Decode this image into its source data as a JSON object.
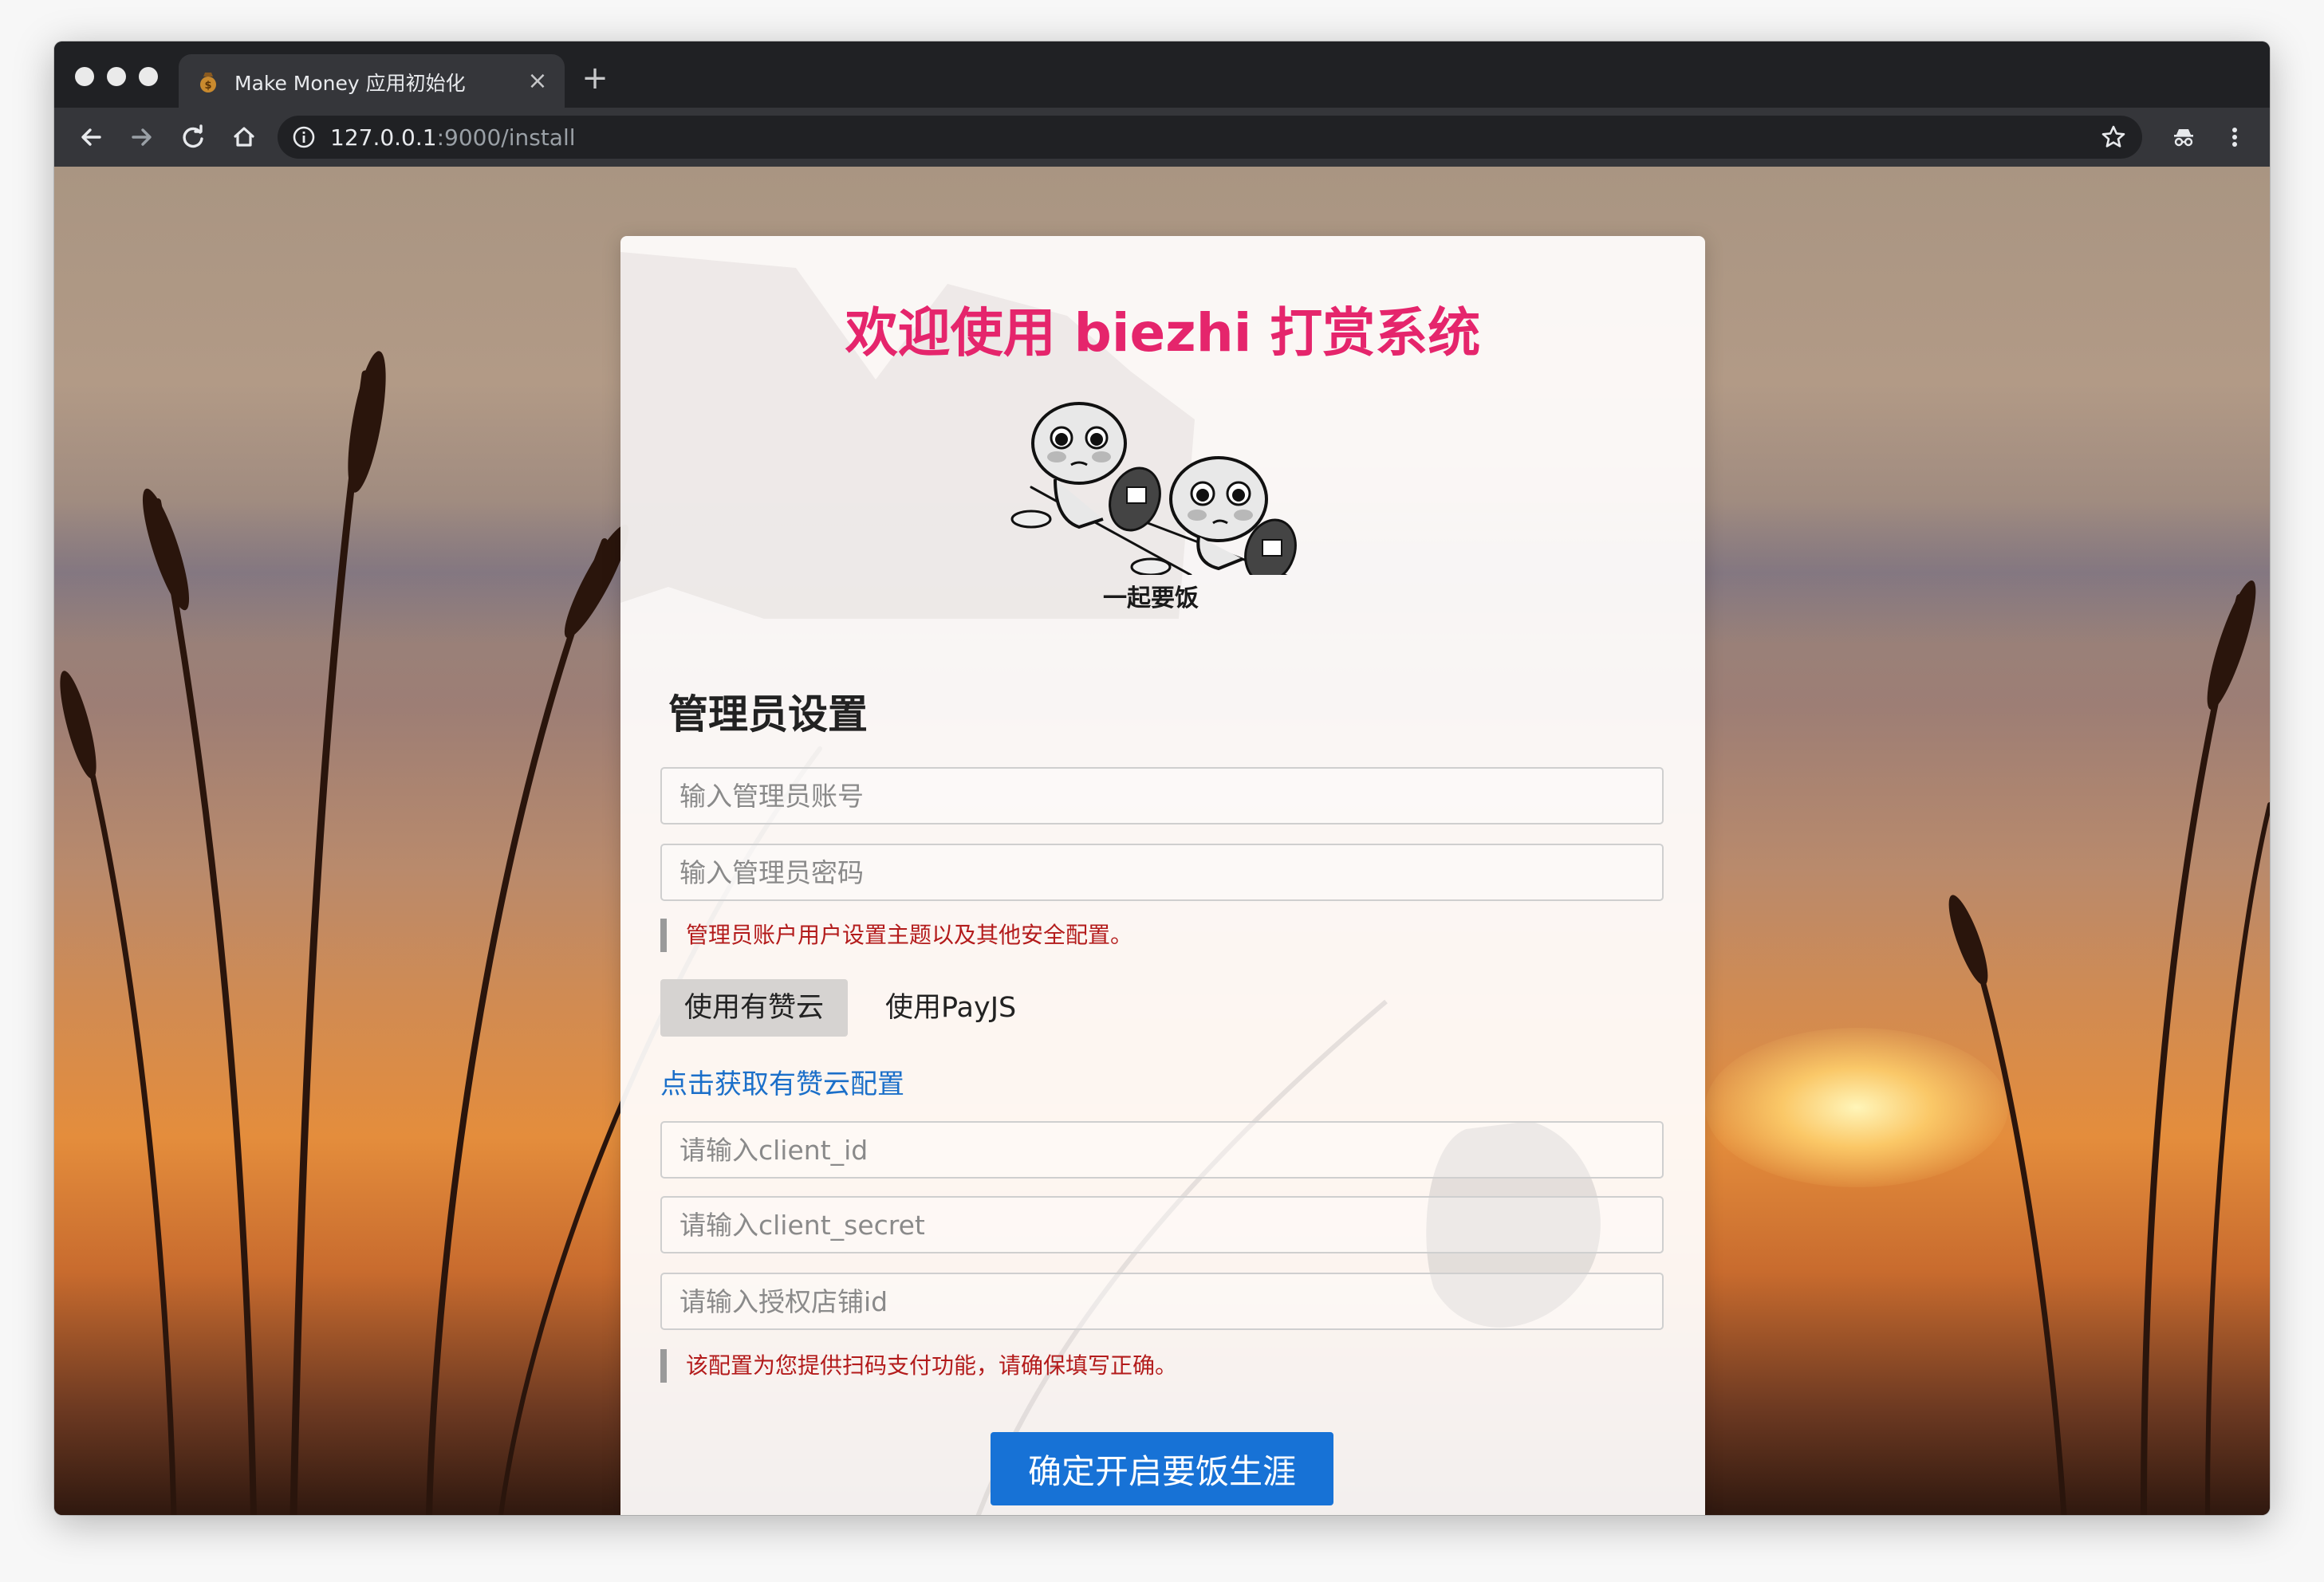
{
  "browser": {
    "tab": {
      "title": "Make Money 应用初始化",
      "close": "×"
    },
    "new_tab": "+",
    "url": {
      "host": "127.0.0.1",
      "path": ":9000/install"
    }
  },
  "page": {
    "title": "欢迎使用 biezhi 打赏系统",
    "meme_caption": "一起要饭",
    "admin": {
      "section_title": "管理员设置",
      "username_placeholder": "输入管理员账号",
      "password_placeholder": "输入管理员密码",
      "hint": "管理员账户用户设置主题以及其他安全配置。"
    },
    "payment": {
      "tabs": [
        {
          "label": "使用有赞云",
          "active": true
        },
        {
          "label": "使用PayJS",
          "active": false
        }
      ],
      "config_link": "点击获取有赞云配置",
      "client_id_placeholder": "请输入client_id",
      "client_secret_placeholder": "请输入client_secret",
      "shop_id_placeholder": "请输入授权店铺id",
      "hint": "该配置为您提供扫码支付功能，请确保填写正确。"
    },
    "submit_label": "确定开启要饭生涯"
  },
  "colors": {
    "title": "#e5256c",
    "link": "#1b6fc9",
    "primary_button": "#1772d6",
    "hint_text": "#b31b1b"
  }
}
